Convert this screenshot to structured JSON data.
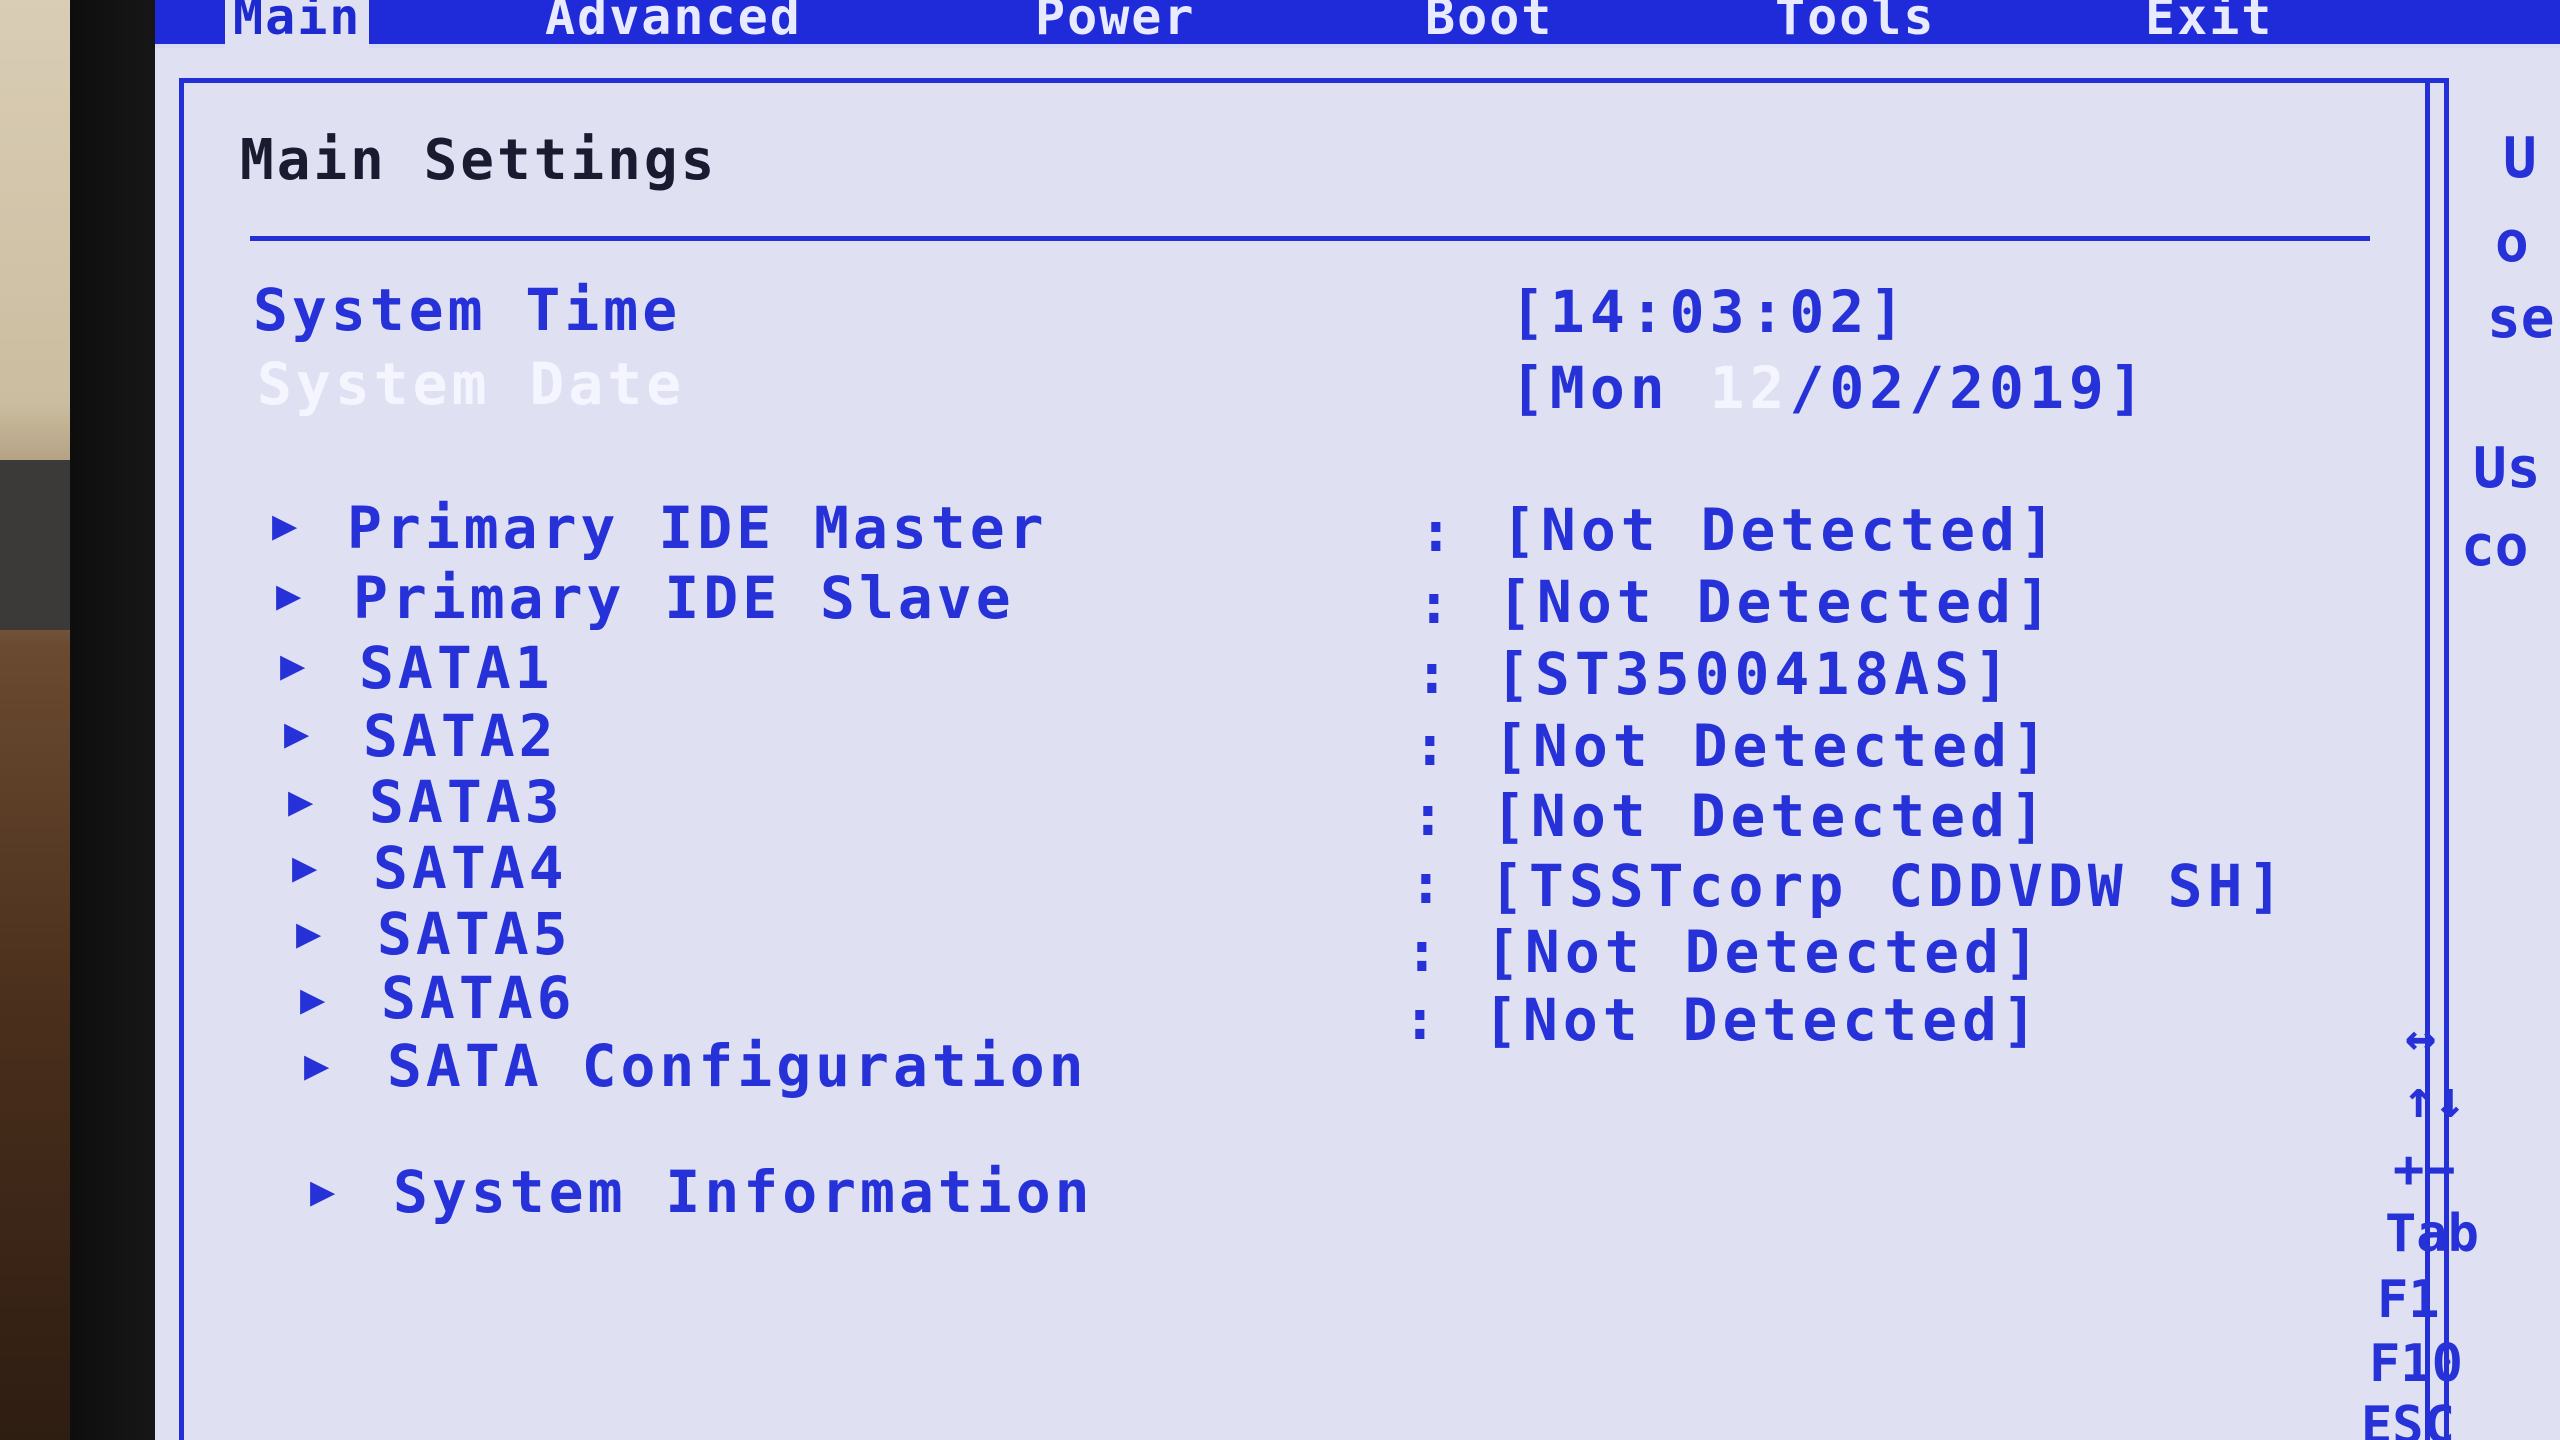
{
  "menu": {
    "tabs": [
      "Main",
      "Advanced",
      "Power",
      "Boot",
      "Tools",
      "Exit"
    ],
    "active_tab": "Main"
  },
  "main": {
    "title": "Main Settings",
    "system_time_label": "System Time",
    "system_time_value": "[14:03:02]",
    "system_date_label": "System Date",
    "system_date_value_prefix": "[Mon ",
    "system_date_value_highlight": "12",
    "system_date_value_suffix": "/02/2019]",
    "separator": ":",
    "devices": [
      {
        "label": "Primary IDE Master",
        "value": "[Not Detected]"
      },
      {
        "label": "Primary IDE Slave",
        "value": "[Not Detected]"
      },
      {
        "label": "SATA1",
        "value": "[ST3500418AS]"
      },
      {
        "label": "SATA2",
        "value": "[Not Detected]"
      },
      {
        "label": "SATA3",
        "value": "[Not Detected]"
      },
      {
        "label": "SATA4",
        "value": "[TSSTcorp CDDVDW SH]"
      },
      {
        "label": "SATA5",
        "value": "[Not Detected]"
      },
      {
        "label": "SATA6",
        "value": "[Not Detected]"
      }
    ],
    "sata_config_label": "SATA Configuration",
    "system_info_label": "System Information"
  },
  "help": {
    "lines": [
      "U",
      "o",
      "se",
      "Us",
      "co"
    ],
    "keys": [
      "↔",
      "↑↓",
      "+−",
      "Tab",
      "F1",
      "F10",
      "ESC"
    ]
  },
  "colors": {
    "bios_blue": "#2632d8",
    "screen_bg": "#dfe1f2",
    "menubar_bg": "#1f2ad8"
  }
}
